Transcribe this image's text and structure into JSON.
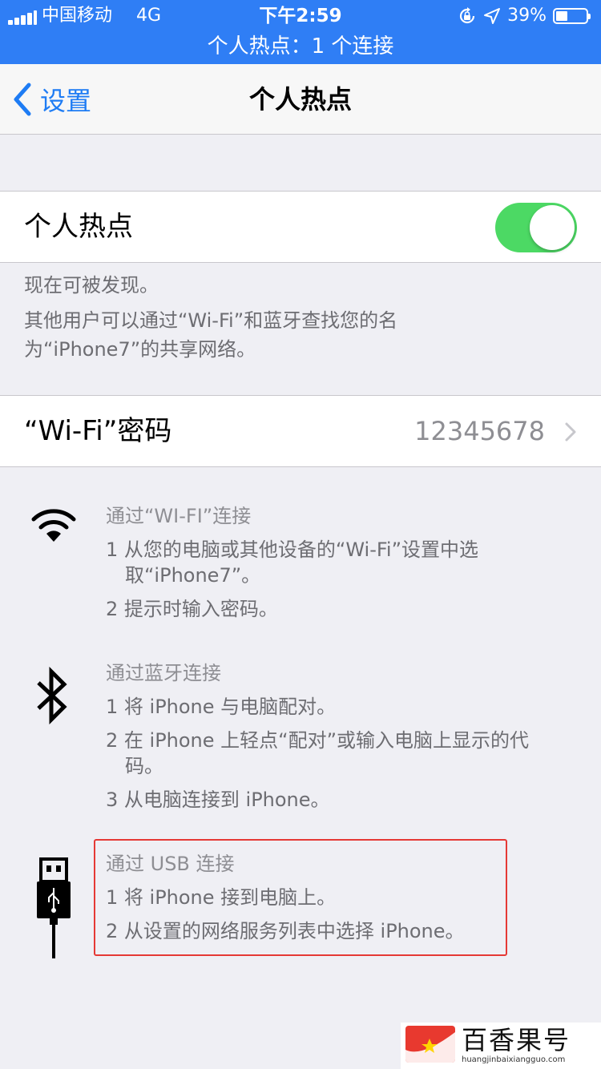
{
  "status_bar": {
    "carrier": "中国移动",
    "network": "4G",
    "time": "下午2:59",
    "battery_percent": "39%",
    "battery_level": 0.39,
    "hotspot_banner": "个人热点：1 个连接",
    "background_color": "#2f7ef5"
  },
  "nav": {
    "back_label": "设置",
    "title": "个人热点",
    "accent_color": "#1e7cf4"
  },
  "hotspot_cell": {
    "label": "个人热点",
    "toggle_on": true,
    "toggle_color": "#4cd964"
  },
  "discover_note": {
    "line1": "现在可被发现。",
    "line2": "其他用户可以通过“Wi-Fi”和蓝牙查找您的名为“iPhone7”的共享网络。"
  },
  "wifi_password_cell": {
    "label": "“Wi-Fi”密码",
    "value": "12345678"
  },
  "instructions": {
    "wifi": {
      "icon": "wifi-icon",
      "title": "通过“WI-FI”连接",
      "steps": [
        "1 从您的电脑或其他设备的“Wi-Fi”设置中选取“iPhone7”。",
        "2 提示时输入密码。"
      ]
    },
    "bluetooth": {
      "icon": "bluetooth-icon",
      "title": "通过蓝牙连接",
      "steps": [
        "1 将 iPhone 与电脑配对。",
        "2 在 iPhone 上轻点“配对”或输入电脑上显示的代码。",
        "3 从电脑连接到 iPhone。"
      ]
    },
    "usb": {
      "icon": "usb-icon",
      "title": "通过 USB 连接",
      "steps": [
        "1 将 iPhone 接到电脑上。",
        "2 从设置的网络服务列表中选择 iPhone。"
      ],
      "highlight_color": "#e53935"
    }
  },
  "watermark": {
    "text": "百香果号",
    "url": "huangjinbaixiangguo.com"
  }
}
